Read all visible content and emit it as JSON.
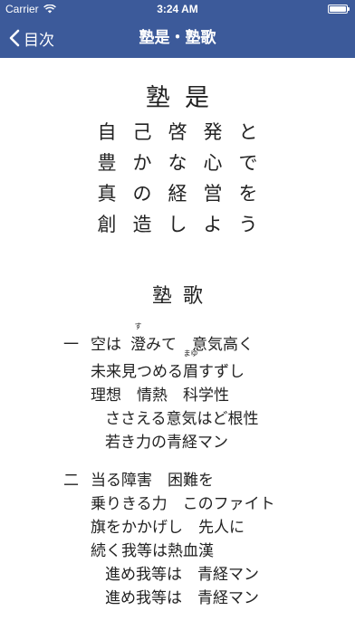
{
  "status": {
    "carrier": "Carrier",
    "time": "3:24 AM"
  },
  "nav": {
    "back_label": "目次",
    "title": "塾是・塾歌"
  },
  "motto": {
    "title": "塾是",
    "lines": [
      "自己啓発と",
      "豊かな心で",
      "真の経営を",
      "創造しよう"
    ]
  },
  "song": {
    "title": "塾歌",
    "verse1": {
      "number": "一",
      "l1_pre": "空は",
      "l1_kanji": "澄",
      "l1_ruby": "す",
      "l1_post": "みて　意気高く",
      "l2_pre": "未来見つめる",
      "l2_kanji": "眉",
      "l2_ruby": "まゆ",
      "l2_post": "すずし",
      "l3": "理想　情熱　科学性",
      "l4": "ささえる意気はど根性",
      "l5": "若き力の青経マン"
    },
    "verse2": {
      "number": "二",
      "l1": "当る障害　困難を",
      "l2": "乗りきる力　このファイト",
      "l3": "旗をかかげし　先人に",
      "l4": "続く我等は熱血漢",
      "l5": "進め我等は　青経マン",
      "l6": "進め我等は　青経マン"
    }
  },
  "colors": {
    "nav_bg": "#3c5a9a",
    "nav_fg": "#ffffff"
  }
}
